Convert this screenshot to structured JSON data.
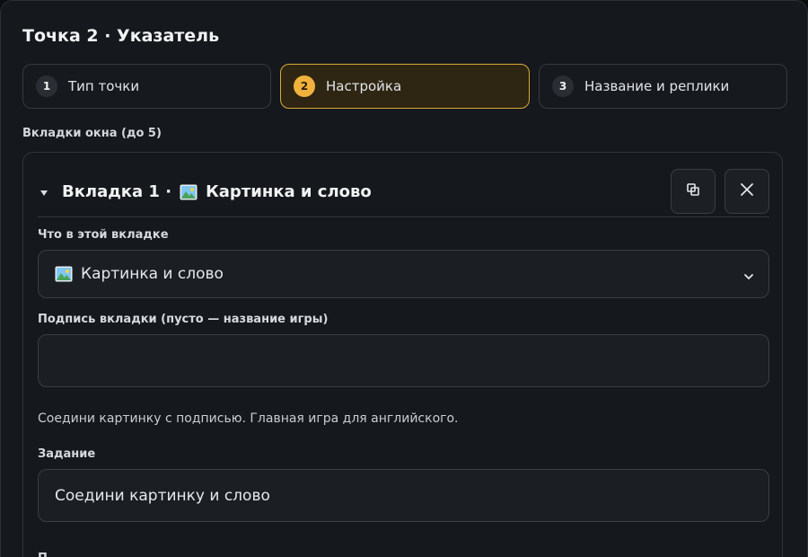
{
  "header": {
    "title": "Точка 2 · Указатель"
  },
  "steps": [
    {
      "num": "1",
      "label": "Тип точки",
      "active": false
    },
    {
      "num": "2",
      "label": "Настройка",
      "active": true
    },
    {
      "num": "3",
      "label": "Название и реплики",
      "active": false
    }
  ],
  "tabs_section": {
    "label": "Вкладки окна (до 5)"
  },
  "tab_card": {
    "title_prefix": "Вкладка 1 ·",
    "title_type": "Картинка и слово",
    "content_label": "Что в этой вкладке",
    "content_value": "Картинка и слово",
    "caption_label": "Подпись вкладки (пусто — название игры)",
    "caption_value": "",
    "caption_placeholder": "",
    "hint": "Соедини картинку с подписью. Главная игра для английского.",
    "task_label": "Задание",
    "task_value": "Соедини картинку и слово",
    "next_label_partial": "П"
  },
  "icons": {
    "collapse": "triangle-down-icon",
    "duplicate": "duplicate-icon",
    "remove": "close-icon",
    "dropdown": "chevron-down-icon",
    "picture": "picture-emoji-icon"
  },
  "colors": {
    "accent": "#f0b23c",
    "active_step_bg": "#2e2613",
    "panel_bg": "#15181c"
  }
}
